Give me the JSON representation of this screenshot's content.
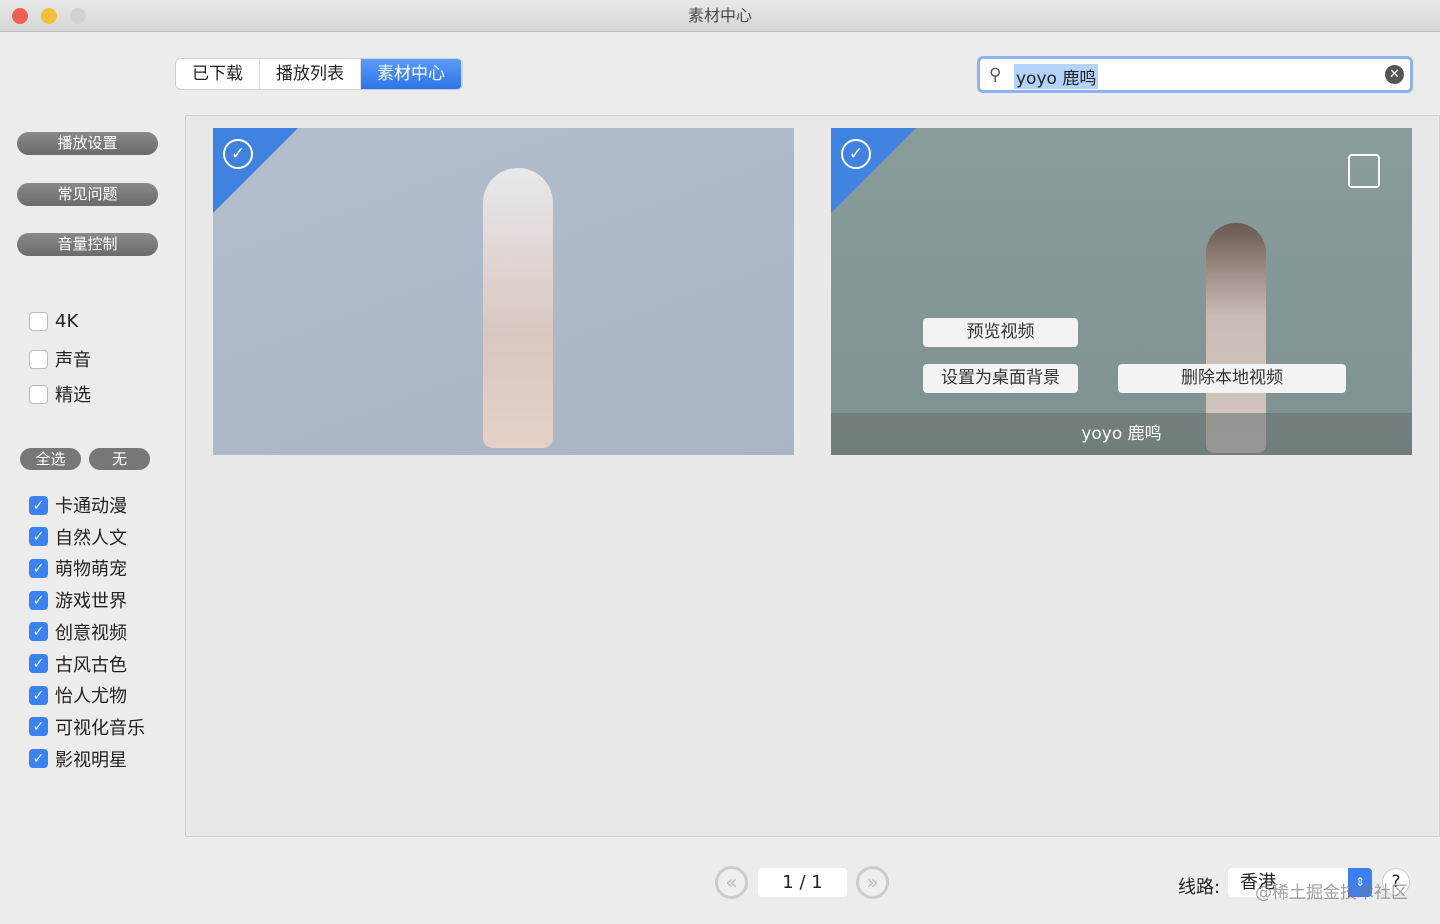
{
  "window": {
    "title": "素材中心"
  },
  "tabs": [
    "已下载",
    "播放列表",
    "素材中心"
  ],
  "search": {
    "value": "yoyo 鹿鸣"
  },
  "sidebar": {
    "buttons": [
      "播放设置",
      "常见问题",
      "音量控制"
    ],
    "filters": [
      {
        "label": "4K",
        "checked": false
      },
      {
        "label": "声音",
        "checked": false
      },
      {
        "label": "精选",
        "checked": false
      }
    ],
    "select_all": "全选",
    "select_none": "无",
    "categories": [
      "卡通动漫",
      "自然人文",
      "萌物萌宠",
      "游戏世界",
      "创意视频",
      "古风古色",
      "怡人尤物",
      "可视化音乐",
      "影视明星"
    ]
  },
  "cards": [
    {
      "title": ""
    },
    {
      "title": "yoyo 鹿鸣",
      "preview": "预览视频",
      "set_bg": "设置为桌面背景",
      "delete": "删除本地视频"
    }
  ],
  "pager": {
    "page": "1 / 1"
  },
  "route": {
    "label": "线路:",
    "value": "香港",
    "help": "?"
  },
  "watermark": "@稀土掘金技术社区"
}
